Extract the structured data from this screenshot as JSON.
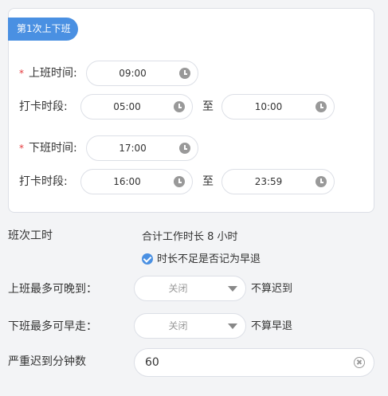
{
  "shift": {
    "tag": "第1次上下班",
    "on_label": "上班时间:",
    "on_time": "09:00",
    "on_range_label": "打卡时段:",
    "on_range_start": "05:00",
    "on_range_to": "至",
    "on_range_end": "10:00",
    "off_label": "下班时间:",
    "off_time": "17:00",
    "off_range_label": "打卡时段:",
    "off_range_start": "16:00",
    "off_range_to": "至",
    "off_range_end": "23:59",
    "required_mark": "*"
  },
  "hours": {
    "label": "班次工时",
    "total": "合计工作时长 8 小时",
    "early_checkbox_label": "时长不足是否记为早退",
    "early_checkbox_checked": true
  },
  "late": {
    "label": "上班最多可晚到：",
    "value": "关闭",
    "suffix": "不算迟到"
  },
  "early": {
    "label": "下班最多可早走：",
    "value": "关闭",
    "suffix": "不算早退"
  },
  "serious": {
    "label": "严重迟到分钟数",
    "value": "60"
  },
  "colors": {
    "accent": "#4a90e2",
    "required": "#e4393c",
    "border": "#dcdfe6",
    "background": "#f3f4f6"
  },
  "icons": {
    "time": "clock-icon",
    "dropdown": "chevron-down-icon",
    "check": "check-circle-icon",
    "clear": "clear-circle-icon"
  }
}
